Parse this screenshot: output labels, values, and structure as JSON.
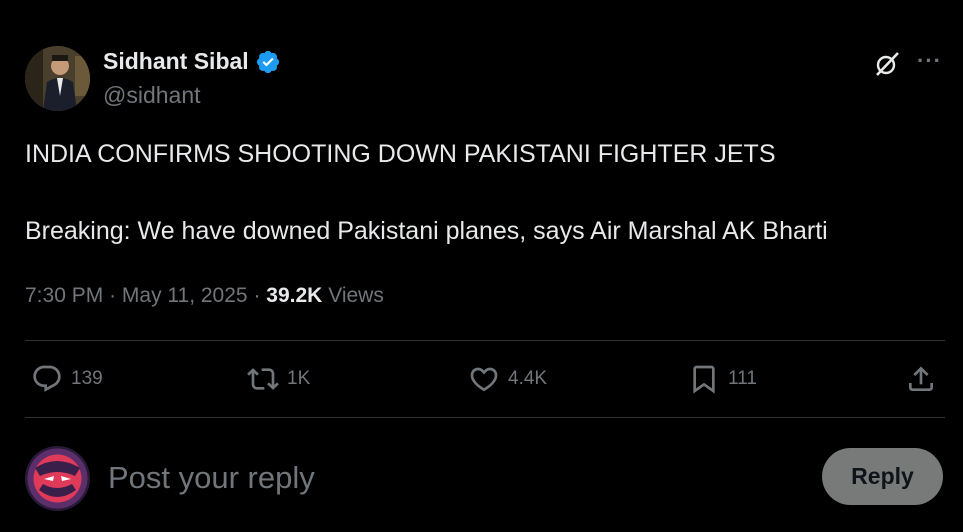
{
  "author": {
    "name": "Sidhant Sibal",
    "handle": "@sidhant"
  },
  "tweet": {
    "line1": "INDIA CONFIRMS SHOOTING DOWN PAKISTANI FIGHTER JETS",
    "line2": "Breaking: We have downed Pakistani planes, says Air Marshal AK Bharti"
  },
  "meta": {
    "time": "7:30 PM",
    "sep": "·",
    "date": "May 11, 2025",
    "views_count": "39.2K",
    "views_label": "Views"
  },
  "actions": {
    "replies": "139",
    "reposts": "1K",
    "likes": "4.4K",
    "bookmarks": "111"
  },
  "icons": {
    "reply": "comment-icon",
    "repost": "repost-icon",
    "like": "heart-icon",
    "bookmark": "bookmark-icon",
    "share": "share-icon",
    "grok": "grok-icon",
    "more": "more-icon",
    "verified": "verified-badge-icon"
  },
  "colors": {
    "background": "#000000",
    "text": "#e7e9ea",
    "muted": "#71767b",
    "verified": "#1d9bf0",
    "reply_button": "#787a7a"
  },
  "composer": {
    "placeholder": "Post your reply",
    "button": "Reply"
  },
  "more_glyph": "···"
}
